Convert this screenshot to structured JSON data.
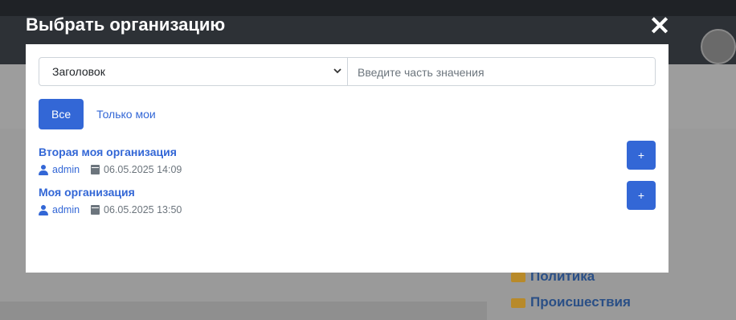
{
  "modal": {
    "title": "Выбрать организацию",
    "close_symbol": "✕"
  },
  "filter": {
    "field_selected": "Заголовок",
    "search_placeholder": "Введите часть значения",
    "search_value": ""
  },
  "tabs": [
    {
      "label": "Все",
      "active": true
    },
    {
      "label": "Только мои",
      "active": false
    }
  ],
  "items": [
    {
      "title": "Вторая моя организация",
      "author": "admin",
      "date": "06.05.2025 14:09",
      "add_label": "+"
    },
    {
      "title": "Моя организация",
      "author": "admin",
      "date": "06.05.2025 13:50",
      "add_label": "+"
    }
  ],
  "background": {
    "links": [
      "Политика",
      "Происшествия"
    ]
  },
  "colors": {
    "accent": "#3367d6",
    "muted": "#6c757d"
  }
}
